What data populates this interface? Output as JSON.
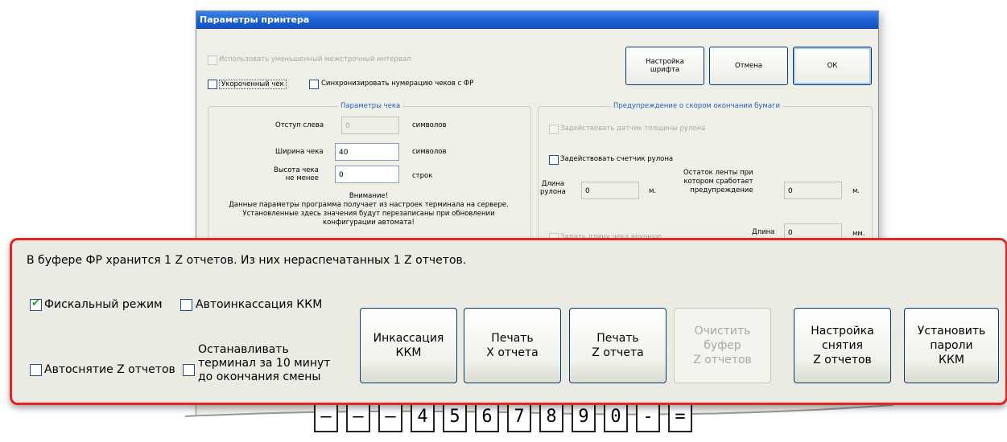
{
  "dialog": {
    "title": "Параметры принтера",
    "use_reduced_spacing": "Использовать уменьшенный межстрочный интервал",
    "short_check": "Укороченный чек",
    "sync_numbering": "Синхронизировать нумерацию чеков с ФР",
    "font_settings": "Настройка\nшрифта",
    "cancel": "Отмена",
    "ok": "ОК",
    "check_params_title": "Параметры чека",
    "indent_left_label": "Отступ слева",
    "indent_left_value": "0",
    "indent_unit": "символов",
    "check_width_label": "Ширина чека",
    "check_width_value": "40",
    "width_unit": "символов",
    "check_height_label": "Высота чека\nне менее",
    "check_height_value": "0",
    "height_unit": "строк",
    "warning_text": "Внимание!\nДанные параметры программа получает из настроек терминала на сервере.\nУстановленные здесь значения будут перезаписаны при обновлении\nконфигурации автомата!",
    "paper_warning_title": "Предупреждение о скором окончании бумаги",
    "use_roll_sensor": "Задействовать датчик толщины рулона",
    "use_roll_counter": "Задействовать счетчик рулона",
    "roll_length_label": "Длина\nрулона",
    "roll_length_value": "0",
    "roll_length_unit": "м.",
    "tape_rest_label": "Остаток ленты при\nкотором сработает\nпредупреждение",
    "tape_rest_value": "0",
    "tape_rest_unit": "м.",
    "set_check_length": "Задать длину чека вручную",
    "length_label": "Длина",
    "length_value": "0",
    "length_unit": "мм."
  },
  "keyboard": [
    "–",
    "–",
    "–",
    "4",
    "5",
    "6",
    "7",
    "8",
    "9",
    "0",
    "-",
    "="
  ],
  "panel": {
    "info": "В буфере ФР хранится 1 Z отчетов. Из них нераспечатанных 1 Z отчетов.",
    "fiscal_mode": "Фискальный режим",
    "fiscal_mode_checked": true,
    "auto_collection": "Автоинкассация ККМ",
    "auto_collection_checked": false,
    "auto_z": "Автоснятие Z отчетов",
    "auto_z_checked": false,
    "stop_terminal": "Останавливать\nтерминал за 10 минут\nдо окончания смены",
    "stop_terminal_checked": false,
    "buttons": [
      {
        "label": "Инкассация\nККМ",
        "enabled": true
      },
      {
        "label": "Печать\nX отчета",
        "enabled": true
      },
      {
        "label": "Печать\nZ отчета",
        "enabled": true
      },
      {
        "label": "Очистить\nбуфер\nZ отчетов",
        "enabled": false
      },
      {
        "label": "Настройка\nснятия\nZ отчетов",
        "enabled": true
      },
      {
        "label": "Установить\nпароли\nККМ",
        "enabled": true
      }
    ]
  },
  "colors": {
    "panel_border": "#e42424",
    "title_bar": "#1b5fd1",
    "check_mark": "#22a322"
  }
}
